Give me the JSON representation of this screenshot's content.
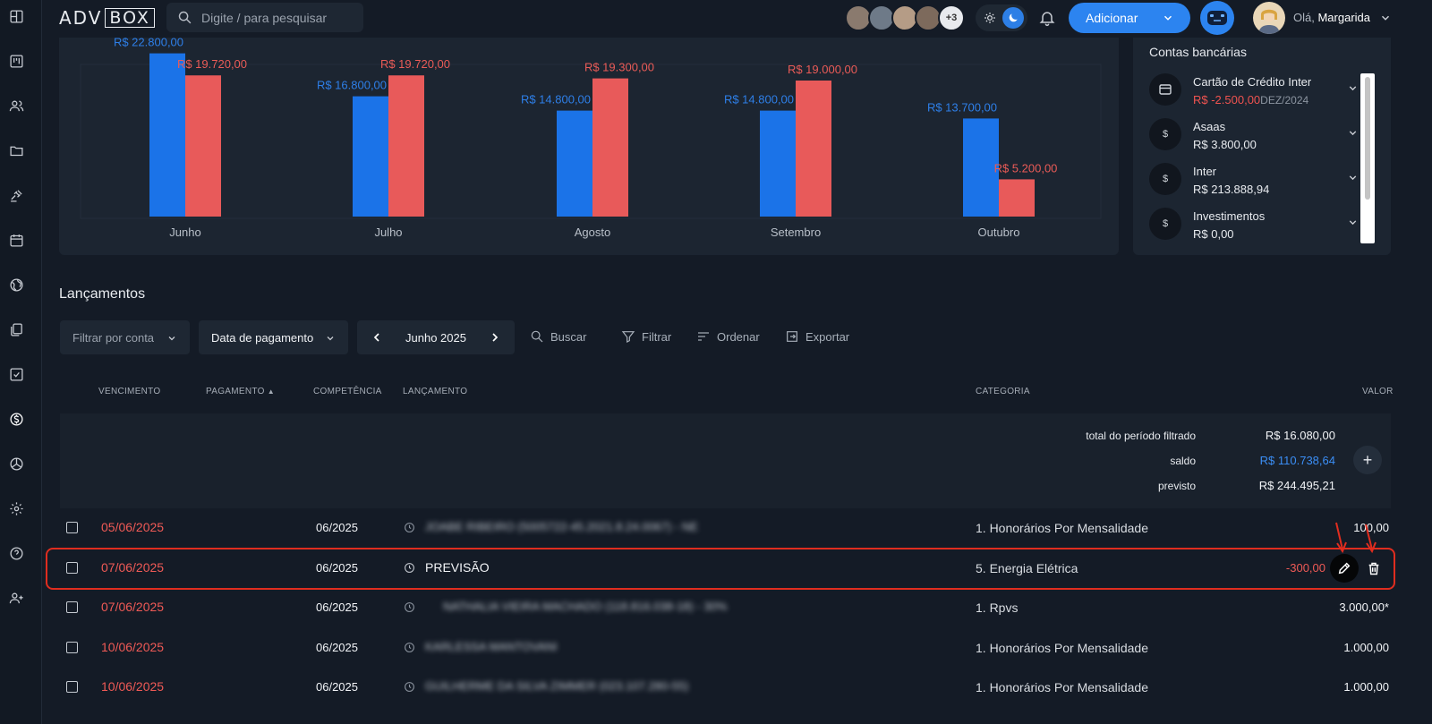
{
  "topbar": {
    "logo_left": "ADV",
    "logo_right": "BOX",
    "search_placeholder": "Digite / para pesquisar",
    "more_avatars": "+3",
    "add_label": "Adicionar",
    "greeting_prefix": "Olá,",
    "user_name": "Margarida"
  },
  "chart_data": {
    "type": "bar",
    "categories": [
      "Junho",
      "Julho",
      "Agosto",
      "Setembro",
      "Outubro"
    ],
    "series": [
      {
        "values": [
          22800,
          16800,
          14800,
          14800,
          13700
        ],
        "labels": [
          "R$ 22.800,00",
          "R$ 16.800,00",
          "R$ 14.800,00",
          "R$ 14.800,00",
          "R$ 13.700,00"
        ],
        "color": "#1b73e8"
      },
      {
        "values": [
          19720,
          19720,
          19300,
          19000,
          5200
        ],
        "labels": [
          "R$ 19.720,00",
          "R$ 19.720,00",
          "R$ 19.300,00",
          "R$ 19.000,00",
          "R$ 5.200,00"
        ],
        "color": "#e85a5a"
      }
    ],
    "ylim": [
      0,
      24000
    ],
    "grid": false
  },
  "accounts": {
    "title": "Contas bancárias",
    "items": [
      {
        "name": "Cartão de Crédito Inter",
        "balance": "R$ -2.500,00",
        "date": "DEZ/2024",
        "icon": "credit-card-icon",
        "negative": true
      },
      {
        "name": "Asaas",
        "balance": "R$ 3.800,00",
        "date": "",
        "icon": "dollar-icon",
        "negative": false
      },
      {
        "name": "Inter",
        "balance": "R$ 213.888,94",
        "date": "",
        "icon": "dollar-icon",
        "negative": false
      },
      {
        "name": "Investimentos",
        "balance": "R$ 0,00",
        "date": "",
        "icon": "dollar-icon",
        "negative": false
      }
    ]
  },
  "lancamentos": {
    "title": "Lançamentos",
    "filter_account": "Filtrar por conta",
    "date_type": "Data de pagamento",
    "month": "Junho 2025",
    "search": "Buscar",
    "filter": "Filtrar",
    "sort": "Ordenar",
    "export": "Exportar",
    "headers": {
      "vencimento": "VENCIMENTO",
      "pagamento": "PAGAMENTO",
      "competencia": "COMPETÊNCIA",
      "lancamento": "LANÇAMENTO",
      "categoria": "CATEGORIA",
      "valor": "VALOR"
    },
    "summary": {
      "total_label": "total do período filtrado",
      "total_value": "R$ 16.080,00",
      "saldo_label": "saldo",
      "saldo_value": "R$ 110.738,64",
      "previsto_label": "previsto",
      "previsto_value": "R$ 244.495,21"
    },
    "rows": [
      {
        "vencimento": "05/06/2025",
        "competencia": "06/2025",
        "descricao": "JOABE RIBEIRO (5005722-45.2021.8.24.0067) - NE",
        "categoria": "1. Honorários Por Mensalidade",
        "valor": "100,00",
        "blurred": true
      },
      {
        "vencimento": "07/06/2025",
        "competencia": "06/2025",
        "descricao": "PREVISÃO",
        "categoria": "5. Energia Elétrica",
        "valor": "-300,00",
        "blurred": false
      },
      {
        "vencimento": "07/06/2025",
        "competencia": "06/2025",
        "descricao": "NATHALIA VIEIRA MACHADO (118.816.038-18) - 30%",
        "categoria": "1. Rpvs",
        "valor": "3.000,00*",
        "blurred": true
      },
      {
        "vencimento": "10/06/2025",
        "competencia": "06/2025",
        "descricao": "KARLESSA MANTOVANI",
        "categoria": "1. Honorários Por Mensalidade",
        "valor": "1.000,00",
        "blurred": true
      },
      {
        "vencimento": "10/06/2025",
        "competencia": "06/2025",
        "descricao": "GUILHERME DA SILVA ZIMMER (023.107.280-55)",
        "categoria": "1. Honorários Por Mensalidade",
        "valor": "1.000,00",
        "blurred": true
      }
    ]
  },
  "colors": {
    "accent": "#2c84f0",
    "negative": "#f05a56",
    "highlight": "#e02d1f"
  }
}
